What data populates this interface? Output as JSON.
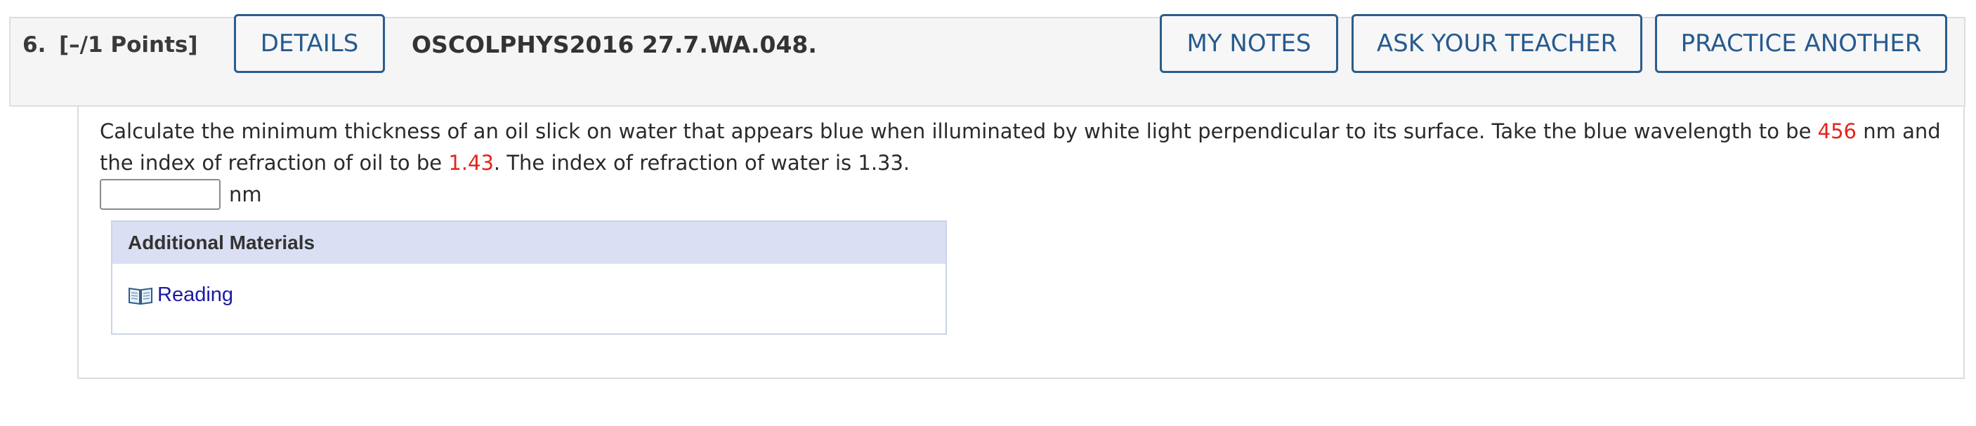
{
  "question": {
    "number": "6.",
    "points": "[–/1 Points]",
    "details_label": "DETAILS",
    "code": "OSCOLPHYS2016 27.7.WA.048.",
    "my_notes_label": "MY NOTES",
    "ask_teacher_label": "ASK YOUR TEACHER",
    "practice_another_label": "PRACTICE ANOTHER"
  },
  "body": {
    "text_part1": "Calculate the minimum thickness of an oil slick on water that appears blue when illuminated by white light perpendicular to its surface. Take the blue wavelength to be ",
    "wavelength": "456",
    "text_part2": " nm and the index of refraction of oil to be ",
    "oil_index": "1.43",
    "text_part3": ". The index of refraction of water is 1.33.",
    "answer_value": "",
    "answer_unit": "nm",
    "highlight_color": "#e5241b"
  },
  "materials": {
    "heading": "Additional Materials",
    "items": [
      {
        "label": "Reading",
        "icon": "book-icon"
      }
    ]
  }
}
